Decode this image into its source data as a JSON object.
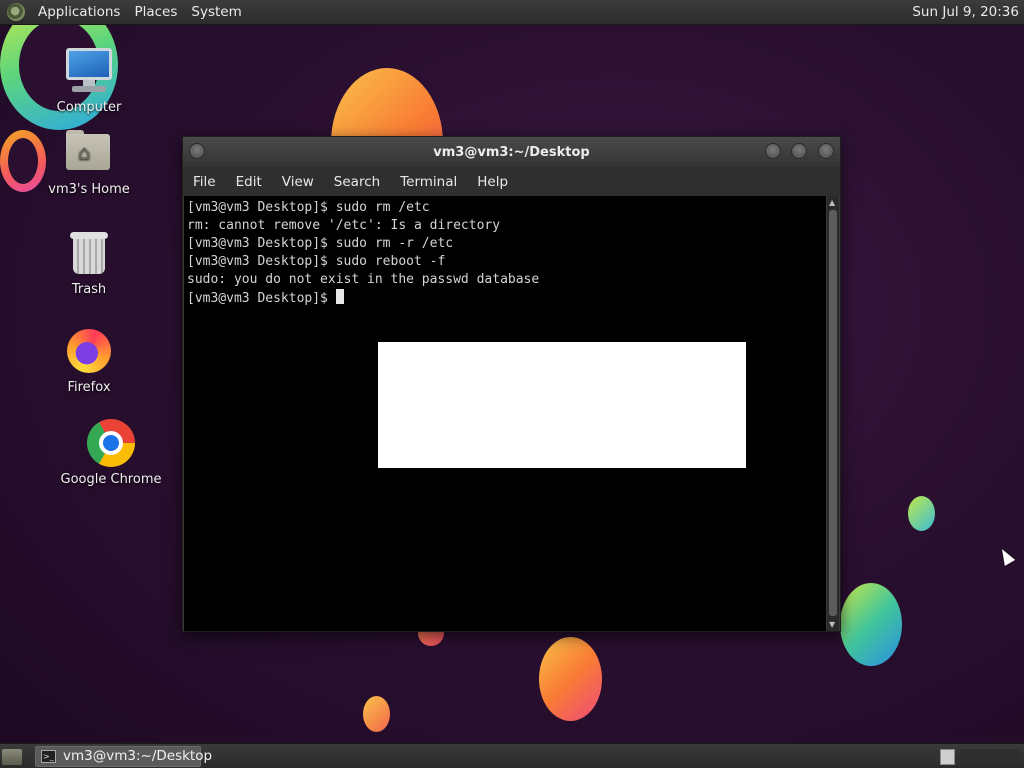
{
  "top_panel": {
    "menus": [
      "Applications",
      "Places",
      "System"
    ],
    "clock": "Sun Jul 9, 20:36"
  },
  "desktop": {
    "icons": [
      {
        "label": "Computer",
        "icon": "computer-icon"
      },
      {
        "label": "vm3's Home",
        "icon": "home-folder-icon"
      },
      {
        "label": "Trash",
        "icon": "trash-icon"
      },
      {
        "label": "Firefox",
        "icon": "firefox-icon"
      },
      {
        "label": "Google Chrome",
        "icon": "chrome-icon"
      }
    ]
  },
  "terminal": {
    "title": "vm3@vm3:~/Desktop",
    "menu": [
      "File",
      "Edit",
      "View",
      "Search",
      "Terminal",
      "Help"
    ],
    "lines": [
      "[vm3@vm3 Desktop]$ sudo rm /etc",
      "rm: cannot remove '/etc': Is a directory",
      "[vm3@vm3 Desktop]$ sudo rm -r /etc",
      "[vm3@vm3 Desktop]$ sudo reboot -f",
      "sudo: you do not exist in the passwd database"
    ],
    "prompt": "[vm3@vm3 Desktop]$ "
  },
  "taskbar": {
    "task_label": "vm3@vm3:~/Desktop"
  }
}
